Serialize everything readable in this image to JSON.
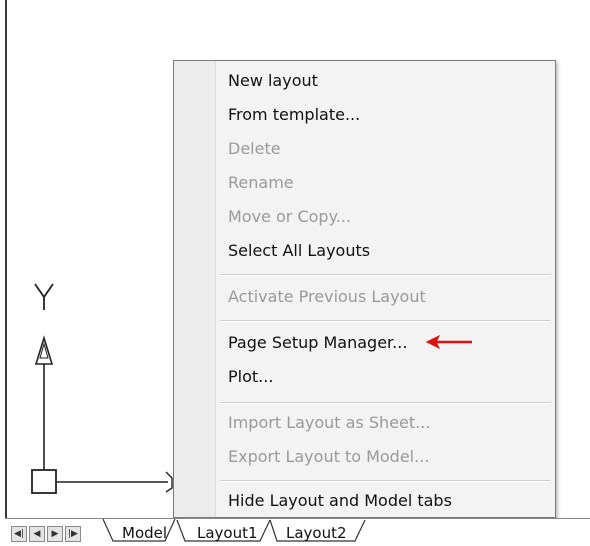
{
  "context_menu": {
    "items": [
      {
        "label": "New layout",
        "enabled": true
      },
      {
        "label": "From template...",
        "enabled": true
      },
      {
        "label": "Delete",
        "enabled": false
      },
      {
        "label": "Rename",
        "enabled": false
      },
      {
        "label": "Move or Copy...",
        "enabled": false
      },
      {
        "label": "Select All Layouts",
        "enabled": true
      },
      {
        "label": "Activate Previous Layout",
        "enabled": false
      },
      {
        "label": "Page Setup Manager...",
        "enabled": true
      },
      {
        "label": "Plot...",
        "enabled": true
      },
      {
        "label": "Import Layout as Sheet...",
        "enabled": false
      },
      {
        "label": "Export Layout to Model...",
        "enabled": false
      },
      {
        "label": "Hide Layout and Model tabs",
        "enabled": true
      }
    ]
  },
  "ucs_icon": {
    "y_label": "Y"
  },
  "tab_bar": {
    "nav_buttons": [
      "first-icon",
      "prev-icon",
      "next-icon",
      "last-icon"
    ],
    "tabs": [
      "Model",
      "Layout1",
      "Layout2"
    ]
  },
  "colors": {
    "annotation_arrow": "#e01010",
    "disabled_text": "#9a9a9a"
  }
}
